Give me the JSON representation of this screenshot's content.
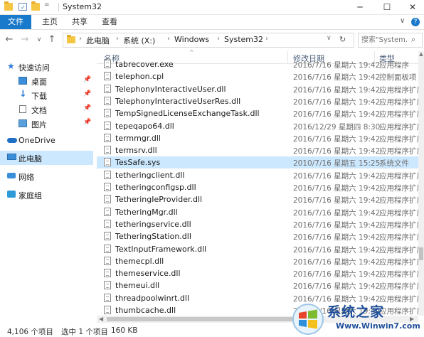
{
  "window": {
    "title": "System32",
    "minimize": "─",
    "maximize": "☐",
    "close": "✕"
  },
  "ribbon": {
    "tabs": [
      "文件",
      "主页",
      "共享",
      "查看"
    ],
    "collapse_icon": "∨",
    "help_icon": "?"
  },
  "address": {
    "breadcrumbs": [
      "此电脑",
      "系统 (X:)",
      "Windows",
      "System32"
    ],
    "search_placeholder": "搜索\"System...",
    "colors": {
      "accent": "#1979ca",
      "selection": "#cce8ff"
    }
  },
  "sidebar": {
    "items": [
      {
        "label": "快速访问",
        "icon": "star-icon"
      },
      {
        "label": "桌面",
        "icon": "desktop-icon",
        "pinned": true
      },
      {
        "label": "下载",
        "icon": "download-icon",
        "pinned": true
      },
      {
        "label": "文档",
        "icon": "document-icon",
        "pinned": true
      },
      {
        "label": "图片",
        "icon": "picture-icon",
        "pinned": true
      },
      {
        "label": "OneDrive",
        "icon": "cloud-icon"
      },
      {
        "label": "此电脑",
        "icon": "computer-icon",
        "selected": true
      },
      {
        "label": "网络",
        "icon": "network-icon"
      },
      {
        "label": "家庭组",
        "icon": "homegroup-icon"
      }
    ]
  },
  "columns": {
    "name": "名称",
    "date": "修改日期",
    "type": "类型"
  },
  "files": [
    {
      "name": "tabrecover.exe",
      "date": "2016/7/16 星期六 19:42",
      "type": "应用程序"
    },
    {
      "name": "telephon.cpl",
      "date": "2016/7/16 星期六 19:42",
      "type": "控制面板项"
    },
    {
      "name": "TelephonyInteractiveUser.dll",
      "date": "2016/7/16 星期六 19:42",
      "type": "应用程序扩展"
    },
    {
      "name": "TelephonyInteractiveUserRes.dll",
      "date": "2016/7/16 星期六 19:42",
      "type": "应用程序扩展"
    },
    {
      "name": "TempSignedLicenseExchangeTask.dll",
      "date": "2016/7/16 星期六 19:42",
      "type": "应用程序扩展"
    },
    {
      "name": "tepeqapo64.dll",
      "date": "2016/12/29 星期四 8:30",
      "type": "应用程序扩展"
    },
    {
      "name": "termmgr.dll",
      "date": "2016/7/16 星期六 19:42",
      "type": "应用程序扩展"
    },
    {
      "name": "termsrv.dll",
      "date": "2016/7/16 星期六 19:42",
      "type": "应用程序扩展"
    },
    {
      "name": "TesSafe.sys",
      "date": "2010/7/16 星期五 15:25",
      "type": "系统文件",
      "selected": true
    },
    {
      "name": "tetheringclient.dll",
      "date": "2016/7/16 星期六 19:42",
      "type": "应用程序扩展"
    },
    {
      "name": "tetheringconfigsp.dll",
      "date": "2016/7/16 星期六 19:42",
      "type": "应用程序扩展"
    },
    {
      "name": "TetheringIeProvider.dll",
      "date": "2016/7/16 星期六 19:42",
      "type": "应用程序扩展"
    },
    {
      "name": "TetheringMgr.dll",
      "date": "2016/7/16 星期六 19:42",
      "type": "应用程序扩展"
    },
    {
      "name": "tetheringservice.dll",
      "date": "2016/7/16 星期六 19:42",
      "type": "应用程序扩展"
    },
    {
      "name": "TetheringStation.dll",
      "date": "2016/7/16 星期六 19:42",
      "type": "应用程序扩展"
    },
    {
      "name": "TextInputFramework.dll",
      "date": "2016/7/16 星期六 19:42",
      "type": "应用程序扩展"
    },
    {
      "name": "themecpl.dll",
      "date": "2016/7/16 星期六 19:42",
      "type": "应用程序扩展"
    },
    {
      "name": "themeservice.dll",
      "date": "2016/7/16 星期六 19:42",
      "type": "应用程序扩展"
    },
    {
      "name": "themeui.dll",
      "date": "2016/7/16 星期六 19:42",
      "type": "应用程序扩展"
    },
    {
      "name": "threadpoolwinrt.dll",
      "date": "2016/7/16 星期六 19:42",
      "type": "应用程序扩展"
    },
    {
      "name": "thumbcache.dll",
      "date": "2016/7/16 星期六 19:42",
      "type": "应用程序扩展"
    }
  ],
  "status": {
    "item_count": "4,106 个项目",
    "selection": "选中 1 个项目",
    "size": "160 KB"
  },
  "watermark": {
    "title": "系统之家",
    "url": "Www.Winwin7.com"
  }
}
